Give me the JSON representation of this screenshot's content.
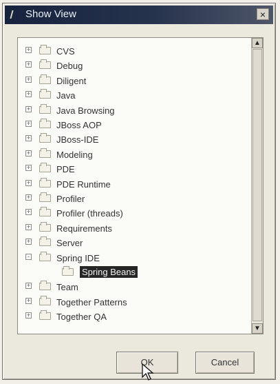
{
  "dialog": {
    "title": "Show View",
    "close_label": "×"
  },
  "tree": {
    "items": [
      {
        "label": "CVS",
        "expander": "+",
        "level": 0
      },
      {
        "label": "Debug",
        "expander": "+",
        "level": 0
      },
      {
        "label": "Diligent",
        "expander": "+",
        "level": 0
      },
      {
        "label": "Java",
        "expander": "+",
        "level": 0
      },
      {
        "label": "Java Browsing",
        "expander": "+",
        "level": 0
      },
      {
        "label": "JBoss AOP",
        "expander": "+",
        "level": 0
      },
      {
        "label": "JBoss-IDE",
        "expander": "+",
        "level": 0
      },
      {
        "label": "Modeling",
        "expander": "+",
        "level": 0
      },
      {
        "label": "PDE",
        "expander": "+",
        "level": 0
      },
      {
        "label": "PDE Runtime",
        "expander": "+",
        "level": 0
      },
      {
        "label": "Profiler",
        "expander": "+",
        "level": 0
      },
      {
        "label": "Profiler (threads)",
        "expander": "+",
        "level": 0
      },
      {
        "label": "Requirements",
        "expander": "+",
        "level": 0
      },
      {
        "label": "Server",
        "expander": "+",
        "level": 0
      },
      {
        "label": "Spring IDE",
        "expander": "-",
        "level": 0
      },
      {
        "label": "Spring Beans",
        "expander": "",
        "level": 1,
        "selected": true
      },
      {
        "label": "Team",
        "expander": "+",
        "level": 0
      },
      {
        "label": "Together Patterns",
        "expander": "+",
        "level": 0
      },
      {
        "label": "Together QA",
        "expander": "+",
        "level": 0
      }
    ]
  },
  "buttons": {
    "ok": "OK",
    "cancel": "Cancel"
  },
  "scrollbar": {
    "up_arrow": "▲",
    "down_arrow": "▼"
  },
  "colors": {
    "titlebar": "#17233e",
    "selection": "#262626"
  },
  "icons": {
    "window": "window-icon",
    "folder": "folder-icon",
    "cursor": "mouse-cursor-icon"
  }
}
